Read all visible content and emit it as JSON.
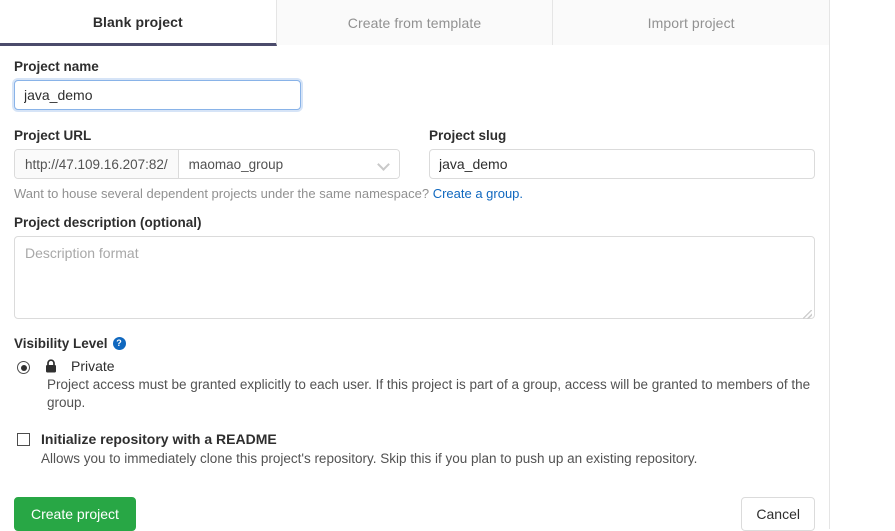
{
  "tabs": [
    {
      "label": "Blank project",
      "active": true
    },
    {
      "label": "Create from template",
      "active": false
    },
    {
      "label": "Import project",
      "active": false
    }
  ],
  "form": {
    "project_name": {
      "label": "Project name",
      "value": "java_demo",
      "placeholder": ""
    },
    "project_url": {
      "label": "Project URL",
      "prefix": "http://47.109.16.207:82/",
      "namespace": "maomao_group"
    },
    "project_slug": {
      "label": "Project slug",
      "value": "java_demo",
      "placeholder": ""
    },
    "namespace_helper": {
      "text": "Want to house several dependent projects under the same namespace?",
      "link_text": "Create a group."
    },
    "description": {
      "label": "Project description (optional)",
      "value": "",
      "placeholder": "Description format"
    },
    "visibility": {
      "label": "Visibility Level",
      "help_icon": "question-mark-icon",
      "options": [
        {
          "name": "Private",
          "icon": "lock-icon",
          "selected": true,
          "description": "Project access must be granted explicitly to each user. If this project is part of a group, access will be granted to members of the group."
        }
      ]
    },
    "readme": {
      "label": "Initialize repository with a README",
      "checked": false,
      "description": "Allows you to immediately clone this project's repository. Skip this if you plan to push up an existing repository."
    }
  },
  "actions": {
    "create_label": "Create project",
    "cancel_label": "Cancel"
  },
  "colors": {
    "accent_link": "#1068bf",
    "primary_button": "#28a745",
    "focus_border": "#89b3e8",
    "active_tab_underline": "#4b4b6b"
  }
}
